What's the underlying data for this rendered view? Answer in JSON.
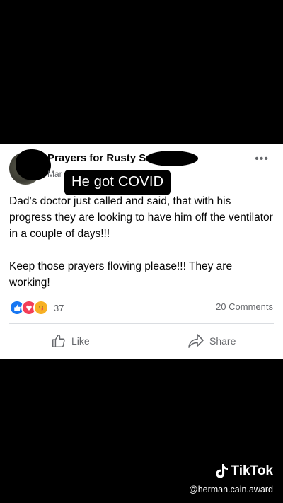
{
  "post": {
    "page_name": "Prayers for Rusty S",
    "date_text": "Mar",
    "overlay_label": "He got COVID",
    "paragraph1": "Dad’s doctor just called and said, that with his progress they are looking to have him off the ventilator in a couple of days!!!",
    "paragraph2": "Keep those prayers flowing please!!! They are working!",
    "reaction_count": "37",
    "comments": "20 Comments",
    "like_label": "Like",
    "share_label": "Share",
    "more_icon": "ellipsis-icon"
  },
  "watermark": {
    "brand": "TikTok",
    "handle": "@herman.cain.award"
  },
  "colors": {
    "like_blue": "#1877f2",
    "love_red": "#f33e58",
    "care_yellow": "#f7b125",
    "muted_text": "#65676b"
  }
}
